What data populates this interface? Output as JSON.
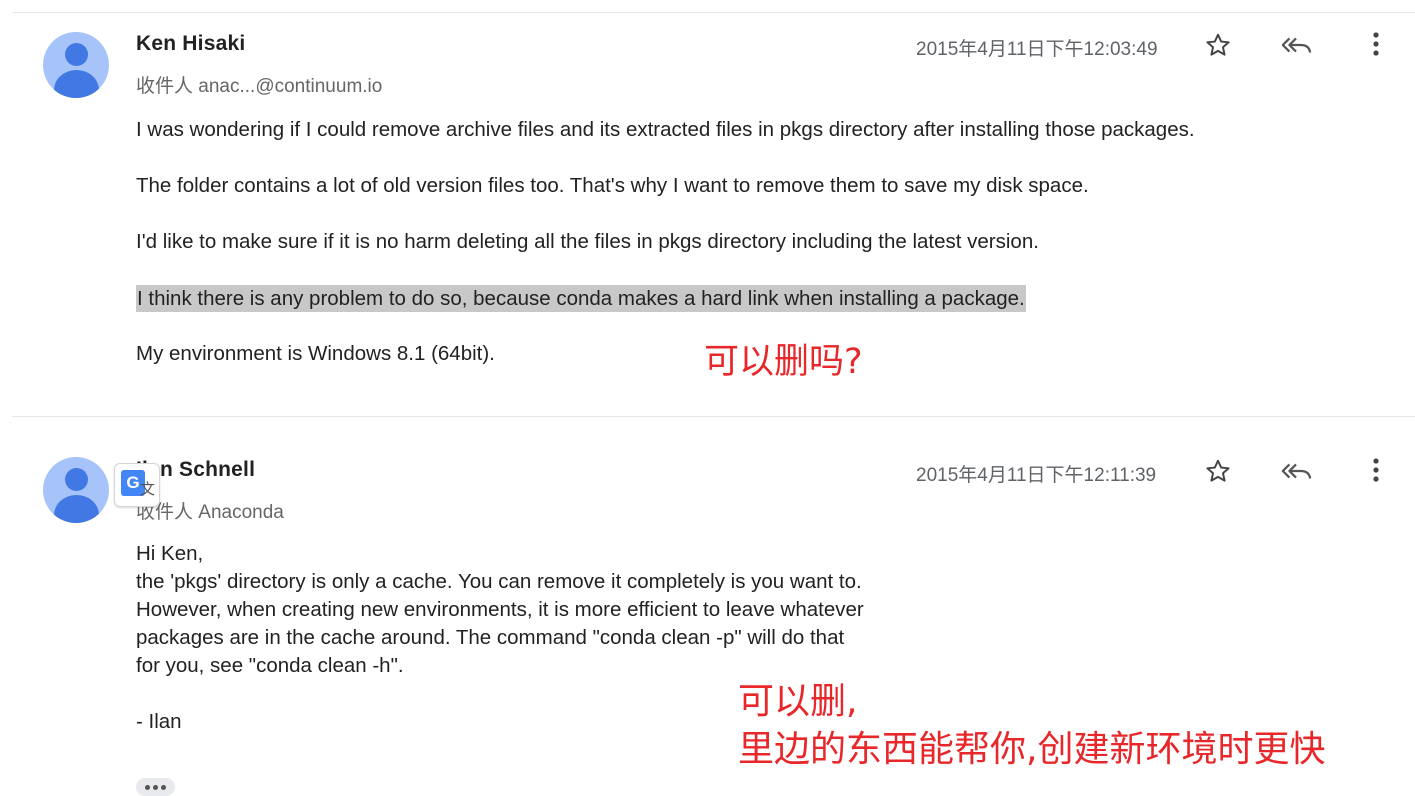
{
  "messages": [
    {
      "sender": "Ken Hisaki",
      "recipient": "收件人 anac...@continuum.io",
      "date": "2015年4月11日下午12:03:49",
      "paragraphs": [
        "I was wondering if I could remove archive files and its extracted files in pkgs directory after installing those packages.",
        "The folder contains a lot of old version files too. That's why I want to remove them to save my disk space.",
        "I'd like to make sure if it is no harm deleting all the files in pkgs directory including the latest version.",
        "I think there is any problem to do so, because conda makes a hard link when installing a package.",
        "My environment is Windows 8.1 (64bit)."
      ],
      "annotation": "可以删吗?"
    },
    {
      "sender": "Ilan Schnell",
      "recipient": "收件人 Anaconda",
      "date": "2015年4月11日下午12:11:39",
      "lines": [
        "Hi Ken,",
        "the 'pkgs' directory is only a cache.  You can remove it completely is you want to.",
        "However, when creating new environments, it is more efficient to leave whatever",
        "packages are in the cache around.  The command \"conda clean -p\" will do that",
        "for you, see \"conda clean -h\".",
        "",
        "- Ilan"
      ],
      "annotation_line1": "可以删,",
      "annotation_line2": "里边的东西能帮你,创建新环境时更快"
    }
  ],
  "translate_badge": {
    "glyph": "G",
    "zh": "文"
  },
  "icons": [
    "star-icon",
    "reply-all-icon",
    "more-vert-icon",
    "avatar-icon",
    "translate-icon"
  ],
  "colors": {
    "annotation": "#e8272a",
    "highlight": "#c8c8c8",
    "avatar_bg": "#a6c4f9",
    "avatar_fg": "#4278e3"
  }
}
